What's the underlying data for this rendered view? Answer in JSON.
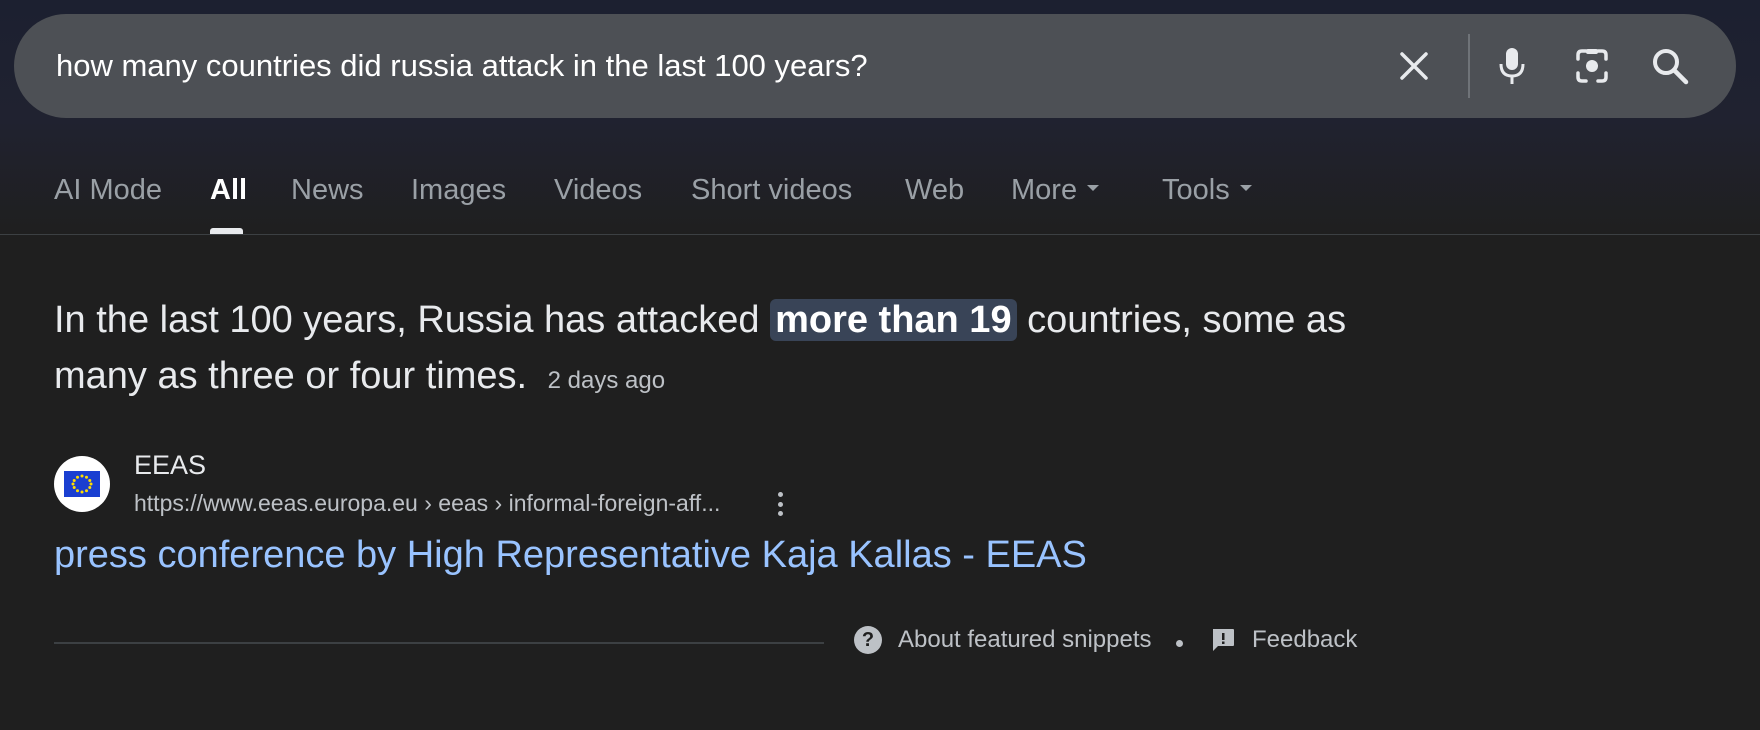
{
  "search": {
    "query": "how many countries did russia attack in the last 100 years?",
    "icons": {
      "clear": "close-icon",
      "voice": "microphone-icon",
      "lens": "camera-lens-icon",
      "submit": "search-icon"
    }
  },
  "tabs": [
    {
      "label": "AI Mode"
    },
    {
      "label": "All",
      "active": true
    },
    {
      "label": "News"
    },
    {
      "label": "Images"
    },
    {
      "label": "Videos"
    },
    {
      "label": "Short videos"
    },
    {
      "label": "Web"
    },
    {
      "label": "More"
    },
    {
      "label": "Tools"
    }
  ],
  "answer": {
    "text_before": "In the last 100 years, Russia has attacked ",
    "highlight": "more than 19",
    "text_after": " countries, some as many as three or four times.",
    "date": "2 days ago"
  },
  "source": {
    "name": "EEAS",
    "url": "https://www.eeas.europa.eu › eeas › informal-foreign-aff...",
    "favicon": "eu-flag-icon",
    "title": "press conference by High Representative Kaja Kallas - EEAS"
  },
  "footer": {
    "about_label": "About featured snippets",
    "feedback_label": "Feedback"
  },
  "colors": {
    "background": "#1f1f1f",
    "searchbar": "#4d5055",
    "link": "#99c3ff",
    "highlight": "#394457"
  }
}
